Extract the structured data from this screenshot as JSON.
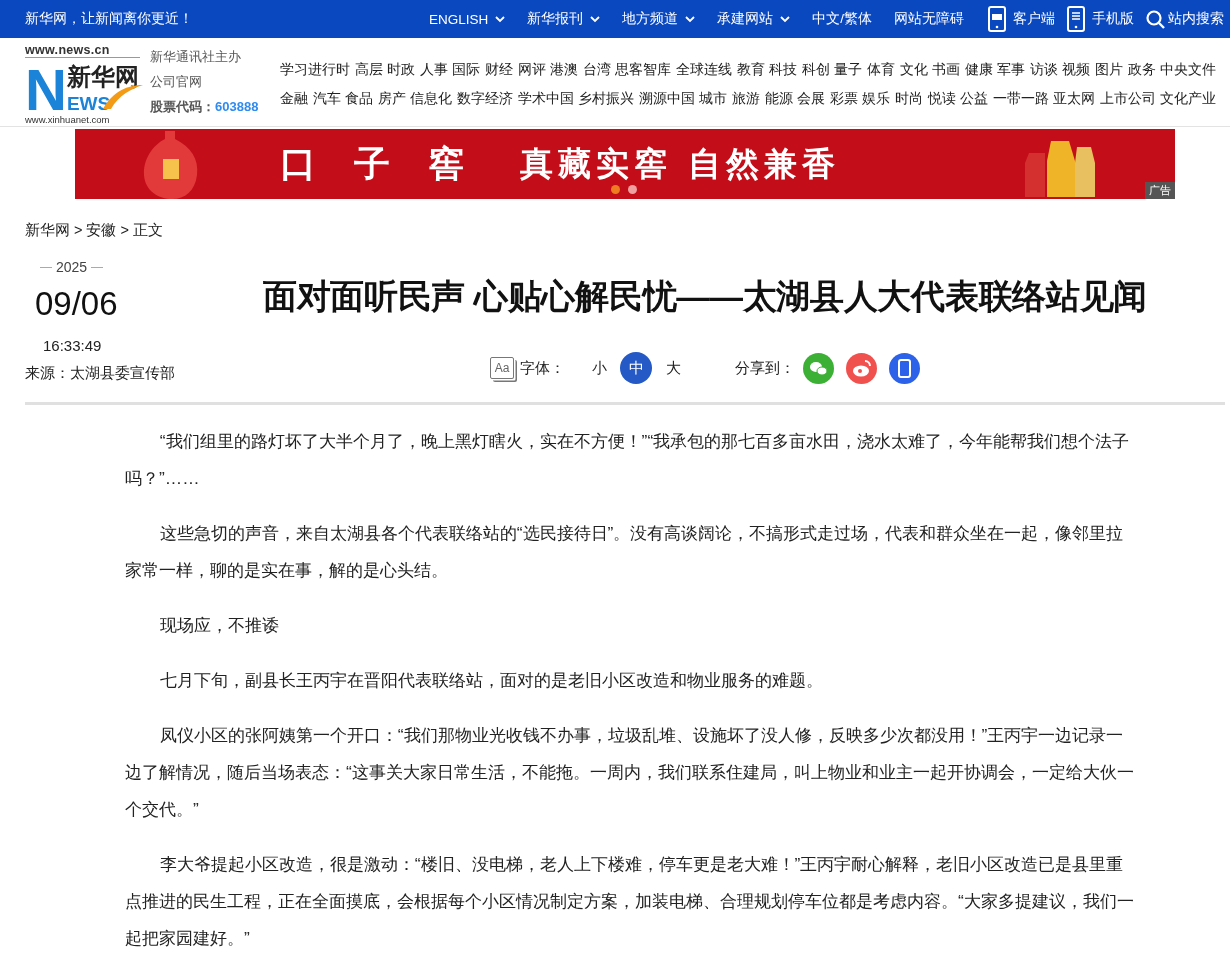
{
  "topbar": {
    "slogan": "新华网，让新闻离你更近！",
    "links": [
      {
        "label": "ENGLISH",
        "dropdown": true
      },
      {
        "label": "新华报刊",
        "dropdown": true
      },
      {
        "label": "地方频道",
        "dropdown": true
      },
      {
        "label": "承建网站",
        "dropdown": true
      },
      {
        "label": "中文/繁体",
        "dropdown": false
      },
      {
        "label": "网站无障碍",
        "dropdown": false
      }
    ],
    "apps": [
      {
        "kind": "client",
        "label": "客户端"
      },
      {
        "kind": "mobile",
        "label": "手机版"
      }
    ],
    "search": "站内搜索"
  },
  "header": {
    "logo": {
      "domain": "www.news.cn",
      "initial": "N",
      "name": "新华网",
      "rest": "EWS",
      "url": "www.xinhuanet.com"
    },
    "org": "新华通讯社主办",
    "official": "公司官网",
    "stock_label": "股票代码：",
    "stock_code": "603888",
    "nav_rows": [
      [
        "学习进行时",
        "高层",
        "时政",
        "人事",
        "国际",
        "财经",
        "网评",
        "港澳",
        "台湾",
        "思客智库",
        "全球连线",
        "教育",
        "科技",
        "科创",
        "量子",
        "体育",
        "文化",
        "书画",
        "健康",
        "军事",
        "访谈",
        "视频",
        "图片",
        "政务",
        "中央文件"
      ],
      [
        "金融",
        "汽车",
        "食品",
        "房产",
        "信息化",
        "数字经济",
        "学术中国",
        "乡村振兴",
        "溯源中国",
        "城市",
        "旅游",
        "能源",
        "会展",
        "彩票",
        "娱乐",
        "时尚",
        "悦读",
        "公益",
        "一带一路",
        "亚太网",
        "上市公司",
        "文化产业"
      ]
    ]
  },
  "ad": {
    "brand": "口子窖",
    "slogan": "真藏实窖 自然兼香",
    "label": "广告",
    "slides": [
      {
        "selected": true
      },
      {
        "selected": false
      }
    ]
  },
  "breadcrumb": [
    {
      "text": "新华网",
      "separator": ">"
    },
    {
      "text": "安徽",
      "separator": ">"
    },
    {
      "text": "正文"
    }
  ],
  "article": {
    "year": "2025",
    "date": "09/06",
    "time": "16:33:49",
    "source": "来源：太湖县委宣传部",
    "title": "面对面听民声 心贴心解民忧——太湖县人大代表联络站见闻",
    "font_icon": "Aa",
    "font_label": "字体：",
    "font_sizes": [
      {
        "label": "小",
        "selected": false
      },
      {
        "label": "中",
        "selected": true
      },
      {
        "label": "大",
        "selected": false
      }
    ],
    "share_label": "分享到：",
    "share": [
      {
        "kind": "wechat"
      },
      {
        "kind": "weibo"
      },
      {
        "kind": "mobile"
      }
    ],
    "paragraphs": [
      "“我们组里的路灯坏了大半个月了，晚上黑灯瞎火，实在不方便！”“我承包的那七百多亩水田，浇水太难了，今年能帮我们想个法子吗？”……",
      "这些急切的声音，来自太湖县各个代表联络站的“选民接待日”。没有高谈阔论，不搞形式走过场，代表和群众坐在一起，像邻里拉家常一样，聊的是实在事，解的是心头结。",
      "现场应，不推诿",
      "七月下旬，副县长王丙宇在晋阳代表联络站，面对的是老旧小区改造和物业服务的难题。",
      "凤仪小区的张阿姨第一个开口：“我们那物业光收钱不办事，垃圾乱堆、设施坏了没人修，反映多少次都没用！”王丙宇一边记录一边了解情况，随后当场表态：“这事关大家日常生活，不能拖。一周内，我们联系住建局，叫上物业和业主一起开协调会，一定给大伙一个交代。”",
      "李大爷提起小区改造，很是激动：“楼旧、没电梯，老人上下楼难，停车更是老大难！”王丙宇耐心解释，老旧小区改造已是县里重点推进的民生工程，正在全面摸底，会根据每个小区情况制定方案，加装电梯、合理规划停车位都是考虑内容。“大家多提建议，我们一起把家园建好。”"
    ]
  }
}
